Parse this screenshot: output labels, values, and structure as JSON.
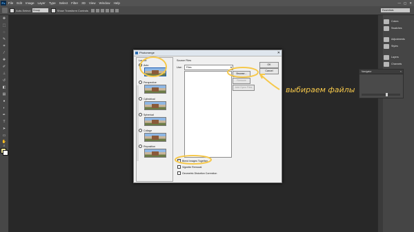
{
  "menubar": {
    "logo": "Ps",
    "items": [
      "File",
      "Edit",
      "Image",
      "Layer",
      "Type",
      "Select",
      "Filter",
      "3D",
      "View",
      "Window",
      "Help"
    ],
    "window_controls": [
      "—",
      "▢",
      "✕"
    ]
  },
  "options_bar": {
    "auto_select_label": "Auto-Select:",
    "auto_select_value": "Group",
    "show_transform_label": "Show Transform Controls",
    "workspace": "Essentials"
  },
  "right_panel": {
    "items": [
      "Colors",
      "Swatches",
      "Adjustments",
      "Styles",
      "Layers",
      "Channels",
      "Paths"
    ]
  },
  "navigator": {
    "title": "Navigator"
  },
  "dialog": {
    "title": "Photomerge",
    "layout_title": "Layout",
    "layouts": [
      {
        "label": "Auto",
        "selected": true
      },
      {
        "label": "Perspective",
        "selected": false
      },
      {
        "label": "Cylindrical",
        "selected": false
      },
      {
        "label": "Spherical",
        "selected": false
      },
      {
        "label": "Collage",
        "selected": false
      },
      {
        "label": "Reposition",
        "selected": false
      }
    ],
    "source_files_title": "Source Files",
    "use_label": "Use:",
    "use_value": "Files",
    "buttons": {
      "ok": "OK",
      "cancel": "Cancel",
      "browse": "Browse...",
      "remove": "Remove",
      "add_open": "Add Open Files"
    },
    "checkboxes": [
      {
        "label": "Blend Images Together",
        "checked": true
      },
      {
        "label": "Vignette Removal",
        "checked": false
      },
      {
        "label": "Geometric Distortion Correction",
        "checked": false
      }
    ]
  },
  "annotation": {
    "text": "выбираем файлы",
    "color": "#f6c84a"
  }
}
